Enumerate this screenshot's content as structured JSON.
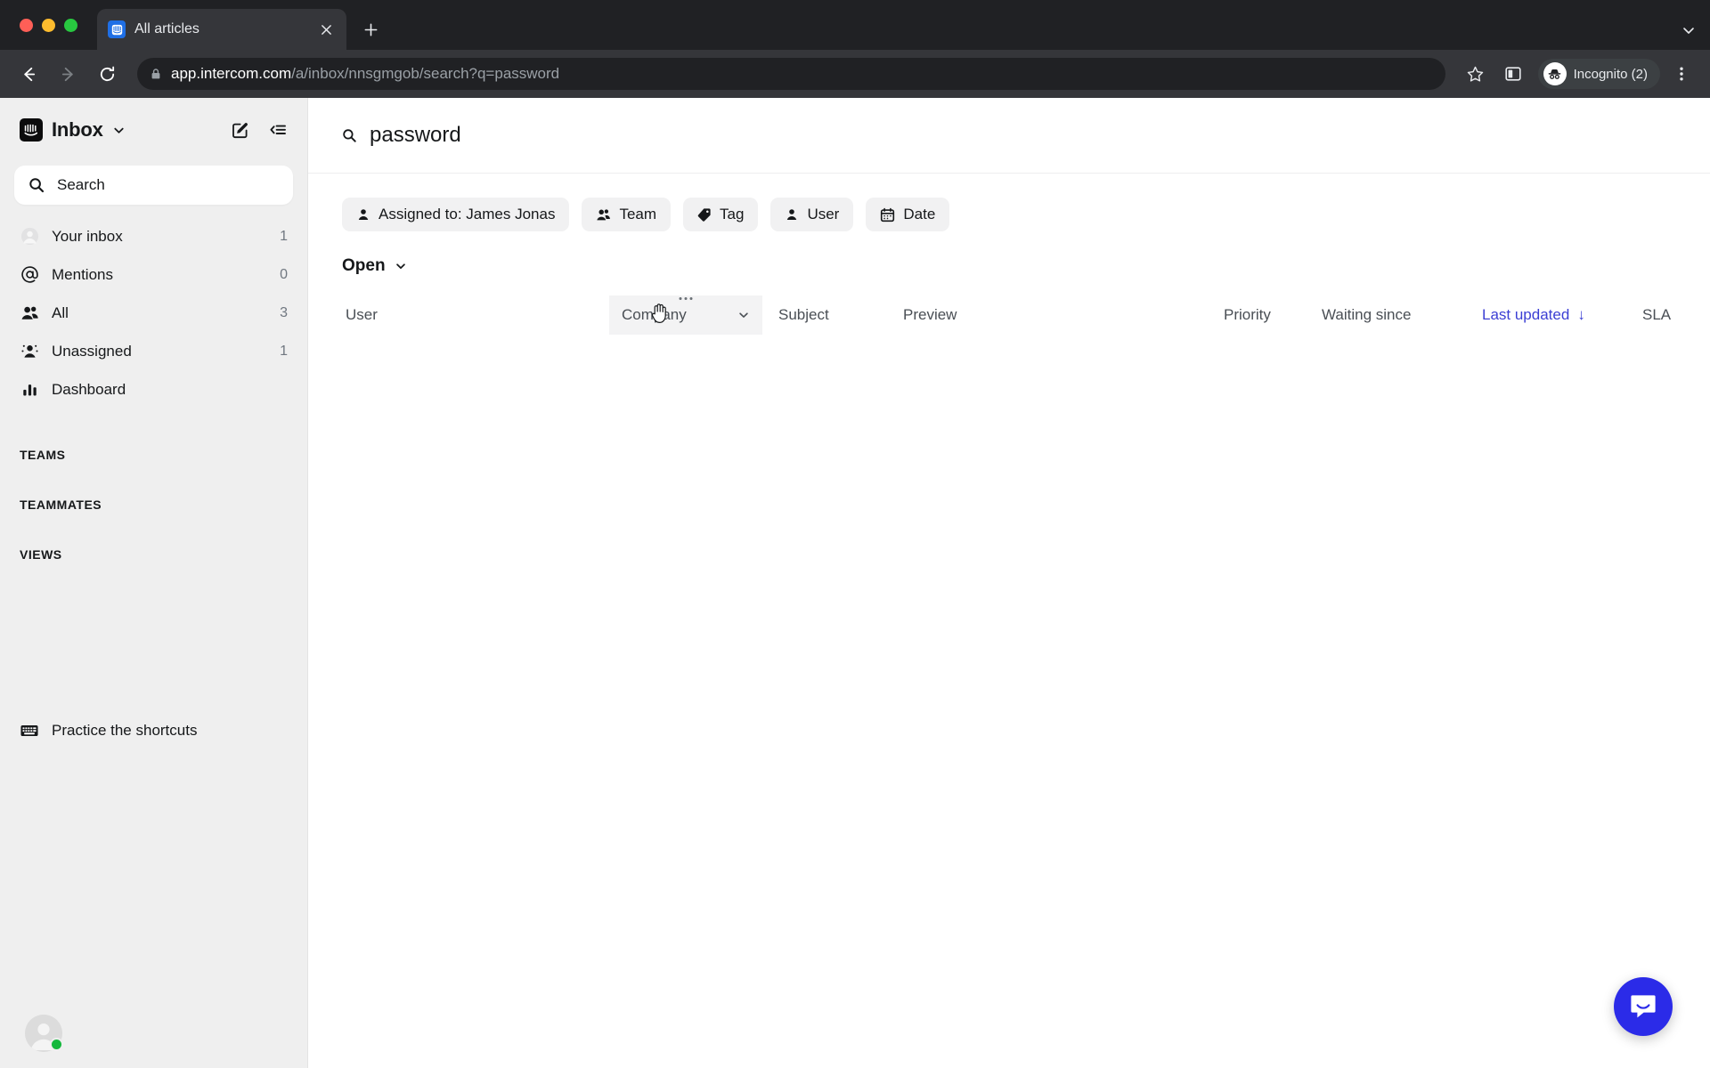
{
  "browser": {
    "tab": {
      "title": "All articles",
      "favicon_icon": "intercom-favicon"
    },
    "new_tab_label": "+",
    "url_domain": "app.intercom.com",
    "url_path": "/a/inbox/nnsgmgob/search?q=password",
    "profile_label": "Incognito (2)",
    "icons": {
      "back": "back-arrow-icon",
      "forward": "forward-arrow-icon",
      "reload": "reload-icon",
      "lock": "lock-icon",
      "bookmark": "star-icon",
      "side_panel": "side-panel-icon",
      "menu": "three-dot-menu-icon",
      "tab_list": "tab-list-chevron-icon"
    }
  },
  "sidebar": {
    "title": "Inbox",
    "search_placeholder": "Search",
    "items": [
      {
        "label": "Your inbox",
        "count": "1",
        "icon": "avatar-icon"
      },
      {
        "label": "Mentions",
        "count": "0",
        "icon": "at-sign-icon"
      },
      {
        "label": "All",
        "count": "3",
        "icon": "people-icon"
      },
      {
        "label": "Unassigned",
        "count": "1",
        "icon": "unassigned-person-icon"
      },
      {
        "label": "Dashboard",
        "count": "",
        "icon": "bar-chart-icon"
      }
    ],
    "sections": [
      {
        "label": "TEAMS"
      },
      {
        "label": "TEAMMATES"
      },
      {
        "label": "VIEWS"
      }
    ],
    "shortcuts_label": "Practice the shortcuts"
  },
  "main": {
    "search_query": "password",
    "filters": [
      {
        "label": "Assigned to: James Jonas",
        "icon": "person-icon"
      },
      {
        "label": "Team",
        "icon": "people-icon"
      },
      {
        "label": "Tag",
        "icon": "tag-icon"
      },
      {
        "label": "User",
        "icon": "person-icon"
      },
      {
        "label": "Date",
        "icon": "calendar-icon"
      }
    ],
    "status_filter": "Open",
    "columns": {
      "user": "User",
      "company": "Company",
      "subject": "Subject",
      "preview": "Preview",
      "priority": "Priority",
      "waiting_since": "Waiting since",
      "last_updated": "Last updated",
      "sort_arrow": "↓",
      "sla": "SLA"
    },
    "rows": []
  },
  "colors": {
    "accent_blue": "#3c3fd4",
    "launcher_blue": "#2b2be8",
    "sidebar_bg": "#efefef",
    "chip_bg": "#f1f1f2",
    "online_green": "#14b83c"
  }
}
